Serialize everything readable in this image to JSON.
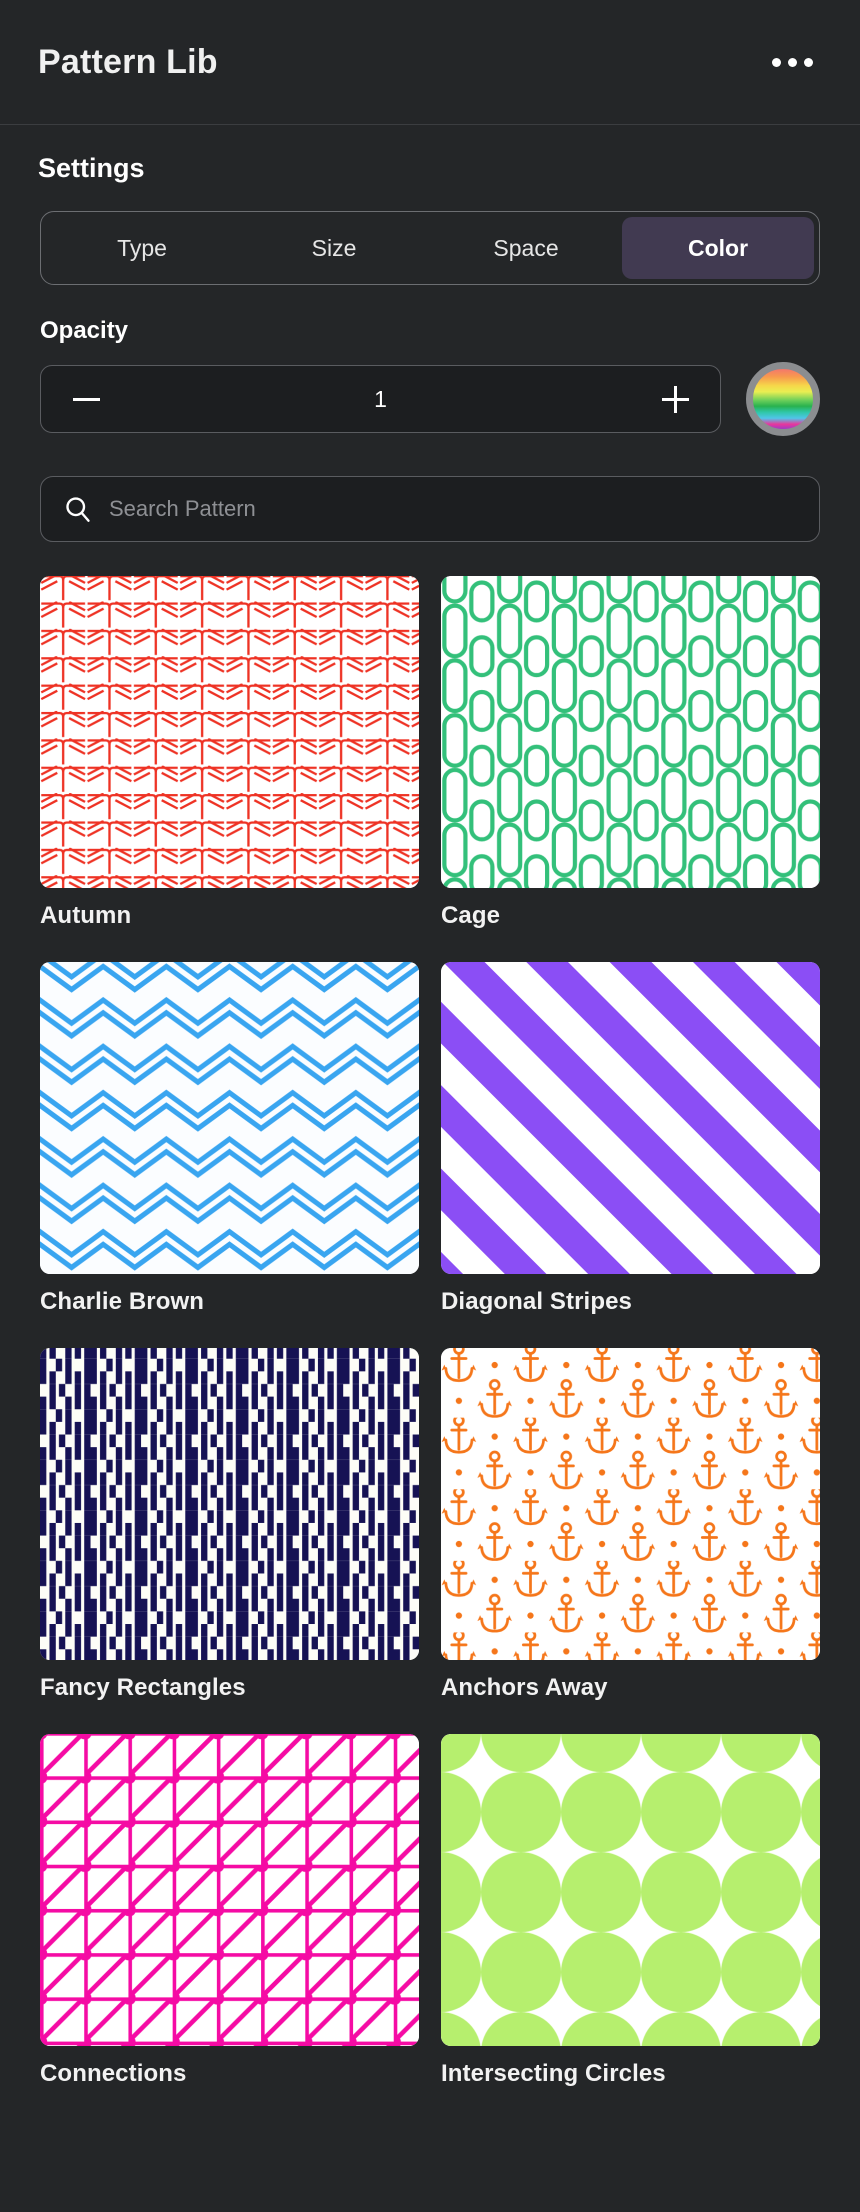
{
  "header": {
    "title": "Pattern Lib",
    "more_icon": "more-horizontal-icon"
  },
  "settings": {
    "heading": "Settings",
    "tabs": [
      {
        "label": "Type",
        "active": false
      },
      {
        "label": "Size",
        "active": false
      },
      {
        "label": "Space",
        "active": false
      },
      {
        "label": "Color",
        "active": true
      }
    ],
    "active_tab": "Color",
    "active_tab_bg": "#413a51",
    "opacity": {
      "label": "Opacity",
      "value": "1",
      "decrement_icon": "minus-icon",
      "increment_icon": "plus-icon",
      "swatch_icon": "rainbow-color-swatch"
    }
  },
  "search": {
    "placeholder": "Search Pattern",
    "value": "",
    "icon": "search-icon"
  },
  "patterns": [
    {
      "name": "Autumn",
      "color": "#ee3224",
      "bg": "#ffffff",
      "style": "herringbone"
    },
    {
      "name": "Cage",
      "color": "#33c07a",
      "bg": "#ffffff",
      "style": "capsules"
    },
    {
      "name": "Charlie Brown",
      "color": "#39a5f0",
      "bg": "#fbfdff",
      "style": "zigzag"
    },
    {
      "name": "Diagonal Stripes",
      "color": "#8b4ef5",
      "bg": "#ffffff",
      "style": "diagonal-stripes"
    },
    {
      "name": "Fancy Rectangles",
      "color": "#161254",
      "bg": "#fdfdf7",
      "style": "fancy-rectangles"
    },
    {
      "name": "Anchors Away",
      "color": "#f5761a",
      "bg": "#ffffff",
      "style": "anchors"
    },
    {
      "name": "Connections",
      "color": "#f50ba4",
      "bg": "#ffffff",
      "style": "connections"
    },
    {
      "name": "Intersecting Circles",
      "color": "#b6ef6e",
      "bg": "#ffffff",
      "style": "intersecting-circles"
    }
  ],
  "theme": {
    "bg": "#242628",
    "field_bg": "#1c1e20",
    "border": "#5a5c60",
    "text": "#ffffff",
    "muted_text": "#8e9094"
  }
}
